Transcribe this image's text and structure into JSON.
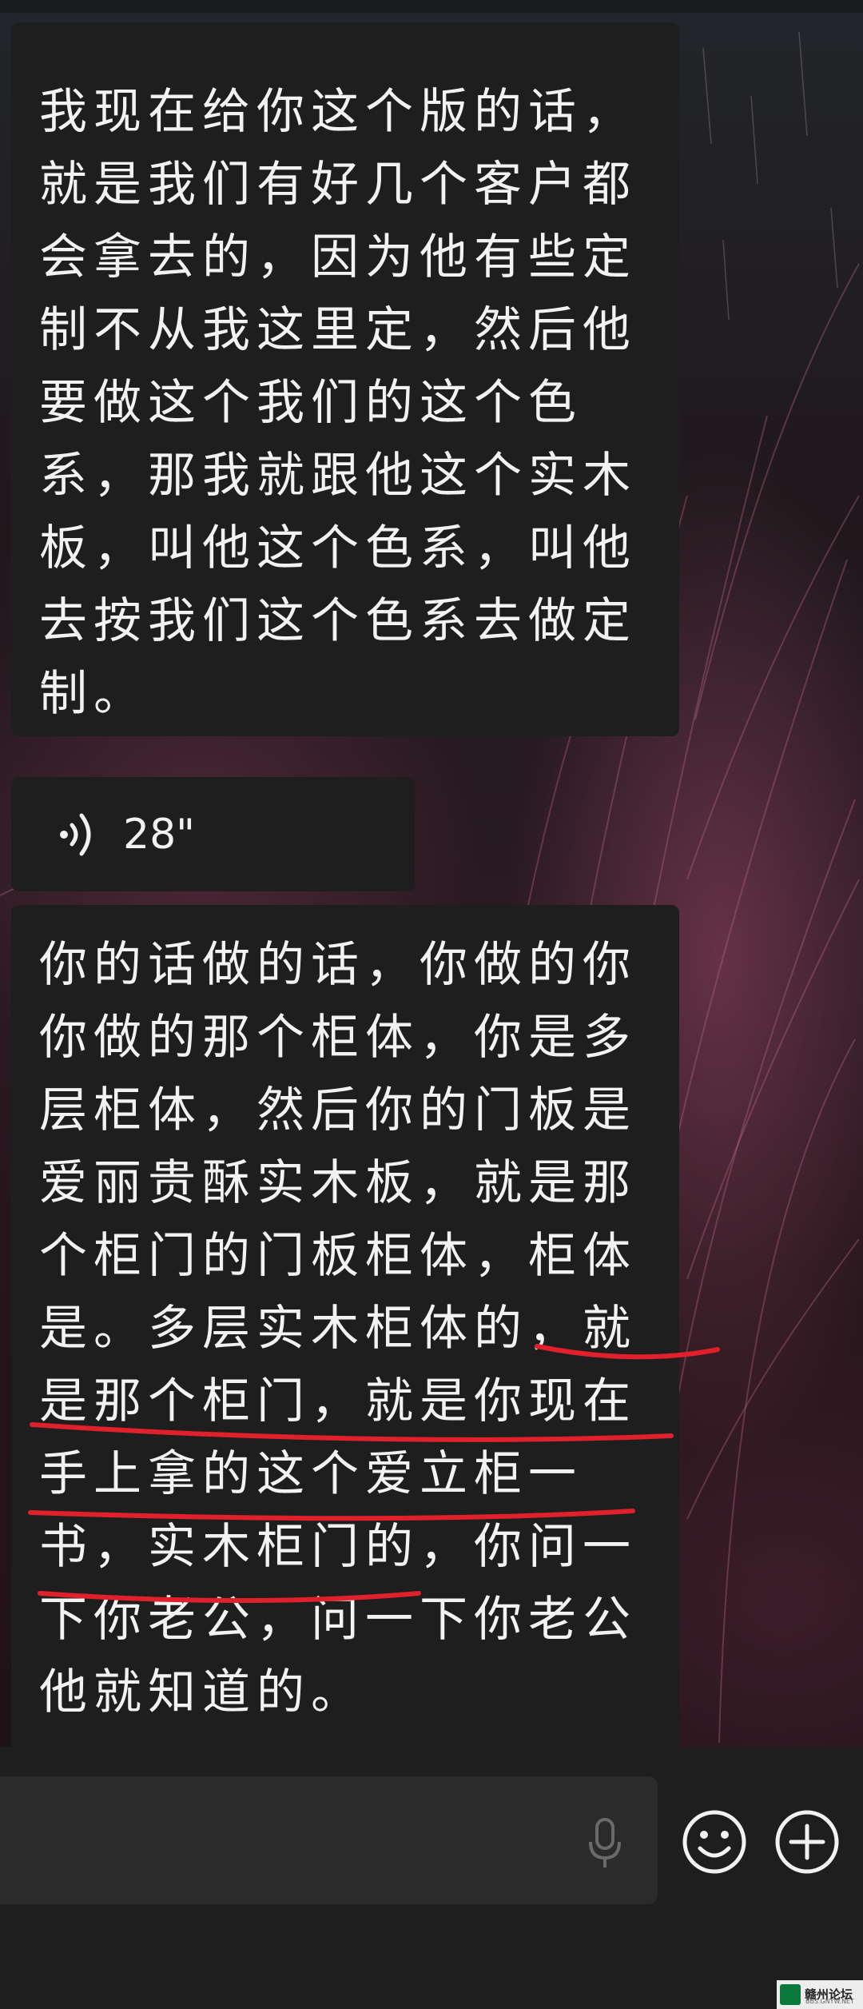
{
  "messages": [
    {
      "type": "text",
      "text": "我现在给你这个版的话，就是我们有好几个客户都会拿去的，因为他有些定制不从我这里定，然后他要做这个我们的这个色系，那我就跟他这个实木板，叫他这个色系，叫他去按我们这个色系去做定制。"
    },
    {
      "type": "voice",
      "duration": "28\""
    },
    {
      "type": "text",
      "text": "你的话做的话，你做的你你做的那个柜体，你是多层柜体，然后你的门板是爱丽贵酥实木板，就是那个柜门的门板柜体，柜体是。多层实木柜体的，就是那个柜门，就是你现在手上拿的这个爱立柜一书，实木柜门的，你问一下你老公，问一下你老公他就知道的。"
    }
  ],
  "input_bar": {
    "mic_icon": "microphone-icon",
    "emoji_icon": "smiley-icon",
    "plus_icon": "plus-icon"
  },
  "watermark": {
    "name": "赣州论坛",
    "url": "BBS.GNYW.NET"
  },
  "colors": {
    "bubble": "#1e1e1e",
    "text": "#f2f2f2",
    "annotation": "#e0202a",
    "input_bar": "#1e1e1e"
  }
}
